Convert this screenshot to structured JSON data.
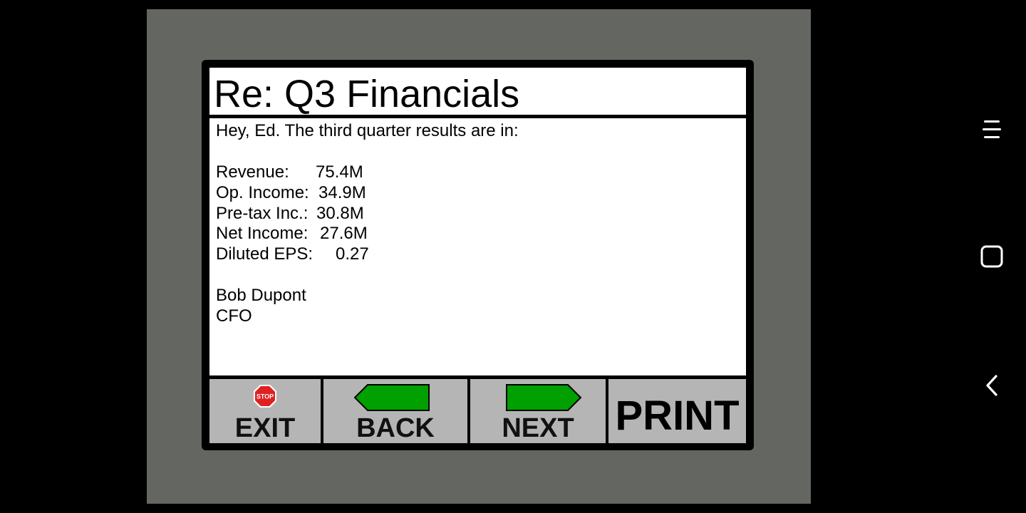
{
  "message": {
    "title": "Re: Q3 Financials",
    "greeting": "Hey, Ed. The third quarter results are in:",
    "financials": [
      {
        "label": "Revenue:",
        "value": "75.4M"
      },
      {
        "label": "Op. Income:",
        "value": "34.9M"
      },
      {
        "label": "Pre-tax Inc.:",
        "value": "30.8M"
      },
      {
        "label": "Net Income:",
        "value": "27.6M"
      },
      {
        "label": "Diluted EPS:",
        "value": "0.27"
      }
    ],
    "signature_name": "Bob Dupont",
    "signature_title": "CFO"
  },
  "toolbar": {
    "exit_label": "EXIT",
    "exit_icon_text": "STOP",
    "back_label": "BACK",
    "next_label": "NEXT",
    "print_label": "PRINT"
  },
  "colors": {
    "bezel": "#646662",
    "button": "#b5b5b5",
    "arrow": "#00a000",
    "stop": "#e02020"
  },
  "system_nav": {
    "icons": [
      "menu-icon",
      "home-square-icon",
      "back-chevron-icon"
    ]
  }
}
